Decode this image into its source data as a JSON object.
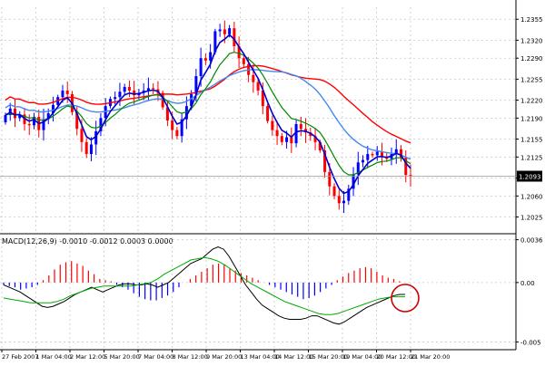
{
  "chart_data": [
    {
      "type": "candlestick",
      "panel": "main",
      "ylim": [
        1.2,
        1.2375
      ],
      "y_ticks": [
        "1.2355",
        "1.2320",
        "1.2290",
        "1.2255",
        "1.2220",
        "1.2190",
        "1.2155",
        "1.2125",
        "1.2090",
        "1.2060",
        "1.2025"
      ],
      "y_tick_values": [
        1.2355,
        1.232,
        1.229,
        1.2255,
        1.222,
        1.219,
        1.2155,
        1.2125,
        1.209,
        1.206,
        1.2025
      ],
      "current_price": "1.2093",
      "current_price_value": 1.2093,
      "grid": true,
      "colors": {
        "background": "#ffffff",
        "grid": "#c8c8c8",
        "bull": "#0000ff",
        "bear": "#ff0000",
        "ma_red": "#ff0000",
        "ma_blue": "#4488ee",
        "ma_green": "#008800",
        "ma_fast": "#0000cc"
      },
      "closes": [
        1.2195,
        1.2206,
        1.219,
        1.2196,
        1.218,
        1.2178,
        1.2192,
        1.217,
        1.2188,
        1.2198,
        1.2212,
        1.2225,
        1.2236,
        1.223,
        1.22,
        1.2172,
        1.215,
        1.213,
        1.2146,
        1.2168,
        1.219,
        1.221,
        1.2222,
        1.2225,
        1.2234,
        1.2242,
        1.2236,
        1.2228,
        1.2232,
        1.2236,
        1.224,
        1.2238,
        1.2232,
        1.2208,
        1.2186,
        1.217,
        1.216,
        1.2188,
        1.221,
        1.223,
        1.226,
        1.229,
        1.2286,
        1.23,
        1.2335,
        1.2338,
        1.233,
        1.234,
        1.231,
        1.229,
        1.228,
        1.2262,
        1.225,
        1.2236,
        1.221,
        1.2185,
        1.217,
        1.216,
        1.215,
        1.2158,
        1.2148,
        1.218,
        1.2172,
        1.2166,
        1.216,
        1.215,
        1.2136,
        1.21,
        1.2076,
        1.206,
        1.2048,
        1.2052,
        1.2072,
        1.2096,
        1.2116,
        1.212,
        1.213,
        1.2128,
        1.2134,
        1.2126,
        1.2122,
        1.213,
        1.2138,
        1.2124,
        1.2095,
        1.2093
      ]
    },
    {
      "type": "macd",
      "panel": "indicator",
      "title": "MACD(12,26,9) -0.0010 -0.0012 0.0003 0.0000",
      "ylim": [
        -0.0055,
        0.0038
      ],
      "y_ticks": [
        "0.0036",
        "0.00",
        "-0.005"
      ],
      "y_tick_values": [
        0.0036,
        0.0,
        -0.005
      ],
      "colors": {
        "hist_up": "#ff0000",
        "hist_down": "#0000ff",
        "macd_line": "#000000",
        "signal_line": "#00aa00",
        "annotation": "#cc0000"
      },
      "series": [
        {
          "values": [
            -0.0002,
            -0.0004,
            -0.0006,
            -0.0008,
            -0.0011,
            -0.0014,
            -0.0017,
            -0.002,
            -0.0021,
            -0.002,
            -0.0018,
            -0.0016,
            -0.0013,
            -0.001,
            -0.0008,
            -0.0006,
            -0.0004,
            -0.0006,
            -0.0008,
            -0.0006,
            -0.0004,
            -0.0002,
            -0.0001,
            -0.0001,
            -0.0002,
            -0.0002,
            -0.0001,
            -0.0002,
            -0.0004,
            -0.0002,
            0.0,
            0.0004,
            0.0008,
            0.0012,
            0.0016,
            0.0018,
            0.002,
            0.0024,
            0.0028,
            0.003,
            0.0028,
            0.0022,
            0.0014,
            0.0006,
            -0.0002,
            -0.0008,
            -0.0014,
            -0.0019,
            -0.0022,
            -0.0025,
            -0.0028,
            -0.003,
            -0.0031,
            -0.0031,
            -0.0031,
            -0.003,
            -0.0028,
            -0.0028,
            -0.003,
            -0.0032,
            -0.0034,
            -0.0035,
            -0.0033,
            -0.003,
            -0.0027,
            -0.0024,
            -0.0021,
            -0.0019,
            -0.0017,
            -0.0015,
            -0.0013,
            -0.0011,
            -0.001,
            -0.001
          ]
        },
        {
          "values": [
            -0.0013,
            -0.0014,
            -0.0015,
            -0.0016,
            -0.0017,
            -0.0017,
            -0.0017,
            -0.0017,
            -0.0016,
            -0.0014,
            -0.0011,
            -0.0009,
            -0.0007,
            -0.0005,
            -0.0004,
            -0.0003,
            -0.0003,
            -0.0003,
            -0.0003,
            -0.0003,
            -0.0002,
            -0.0001,
            0.0,
            0.0003,
            0.0007,
            0.001,
            0.0013,
            0.0016,
            0.0019,
            0.002,
            0.0021,
            0.002,
            0.0018,
            0.0015,
            0.0011,
            0.0007,
            0.0003,
            -0.0001,
            -0.0004,
            -0.0007,
            -0.001,
            -0.0013,
            -0.0016,
            -0.0018,
            -0.002,
            -0.0022,
            -0.0024,
            -0.0026,
            -0.0027,
            -0.0027,
            -0.0026,
            -0.0024,
            -0.0022,
            -0.002,
            -0.0018,
            -0.0016,
            -0.0014,
            -0.0013,
            -0.0012,
            -0.0012,
            -0.0012
          ]
        },
        {
          "values": [
            -0.0002,
            -0.0003,
            -0.0004,
            -0.0006,
            -0.0005,
            -0.0004,
            -0.0002,
            0.0002,
            0.0006,
            0.0011,
            0.0015,
            0.0017,
            0.0018,
            0.0016,
            0.0014,
            0.001,
            0.0007,
            0.0003,
            0.0002,
            0.0001,
            -0.0002,
            -0.0004,
            -0.0006,
            -0.0009,
            -0.0012,
            -0.0014,
            -0.0015,
            -0.0015,
            -0.0013,
            -0.0011,
            -0.0008,
            -0.0004,
            0.0,
            0.0003,
            0.0006,
            0.0009,
            0.0012,
            0.0015,
            0.0016,
            0.0015,
            0.0012,
            0.001,
            0.0008,
            0.0006,
            0.0004,
            0.0002,
            0.0,
            -0.0002,
            -0.0004,
            -0.0006,
            -0.0008,
            -0.001,
            -0.0012,
            -0.0014,
            -0.0013,
            -0.0011,
            -0.0008,
            -0.0005,
            -0.0002,
            0.0002,
            0.0005,
            0.0008,
            0.001,
            0.0012,
            0.0013,
            0.0012,
            0.0009,
            0.0006,
            0.0004,
            0.0003,
            0.0001,
            0.0
          ]
        }
      ]
    }
  ],
  "x_axis": {
    "labels": [
      "27 Feb 2007",
      "1 Mar 04:00",
      "2 Mar 12:00",
      "5 Mar 20:00",
      "7 Mar 04:00",
      "8 Mar 12:00",
      "9 Mar 20:00",
      "13 Mar 04:00",
      "14 Mar 12:00",
      "15 Mar 20:00",
      "19 Mar 04:00",
      "20 Mar 12:00",
      "21 Mar 20:00"
    ]
  }
}
